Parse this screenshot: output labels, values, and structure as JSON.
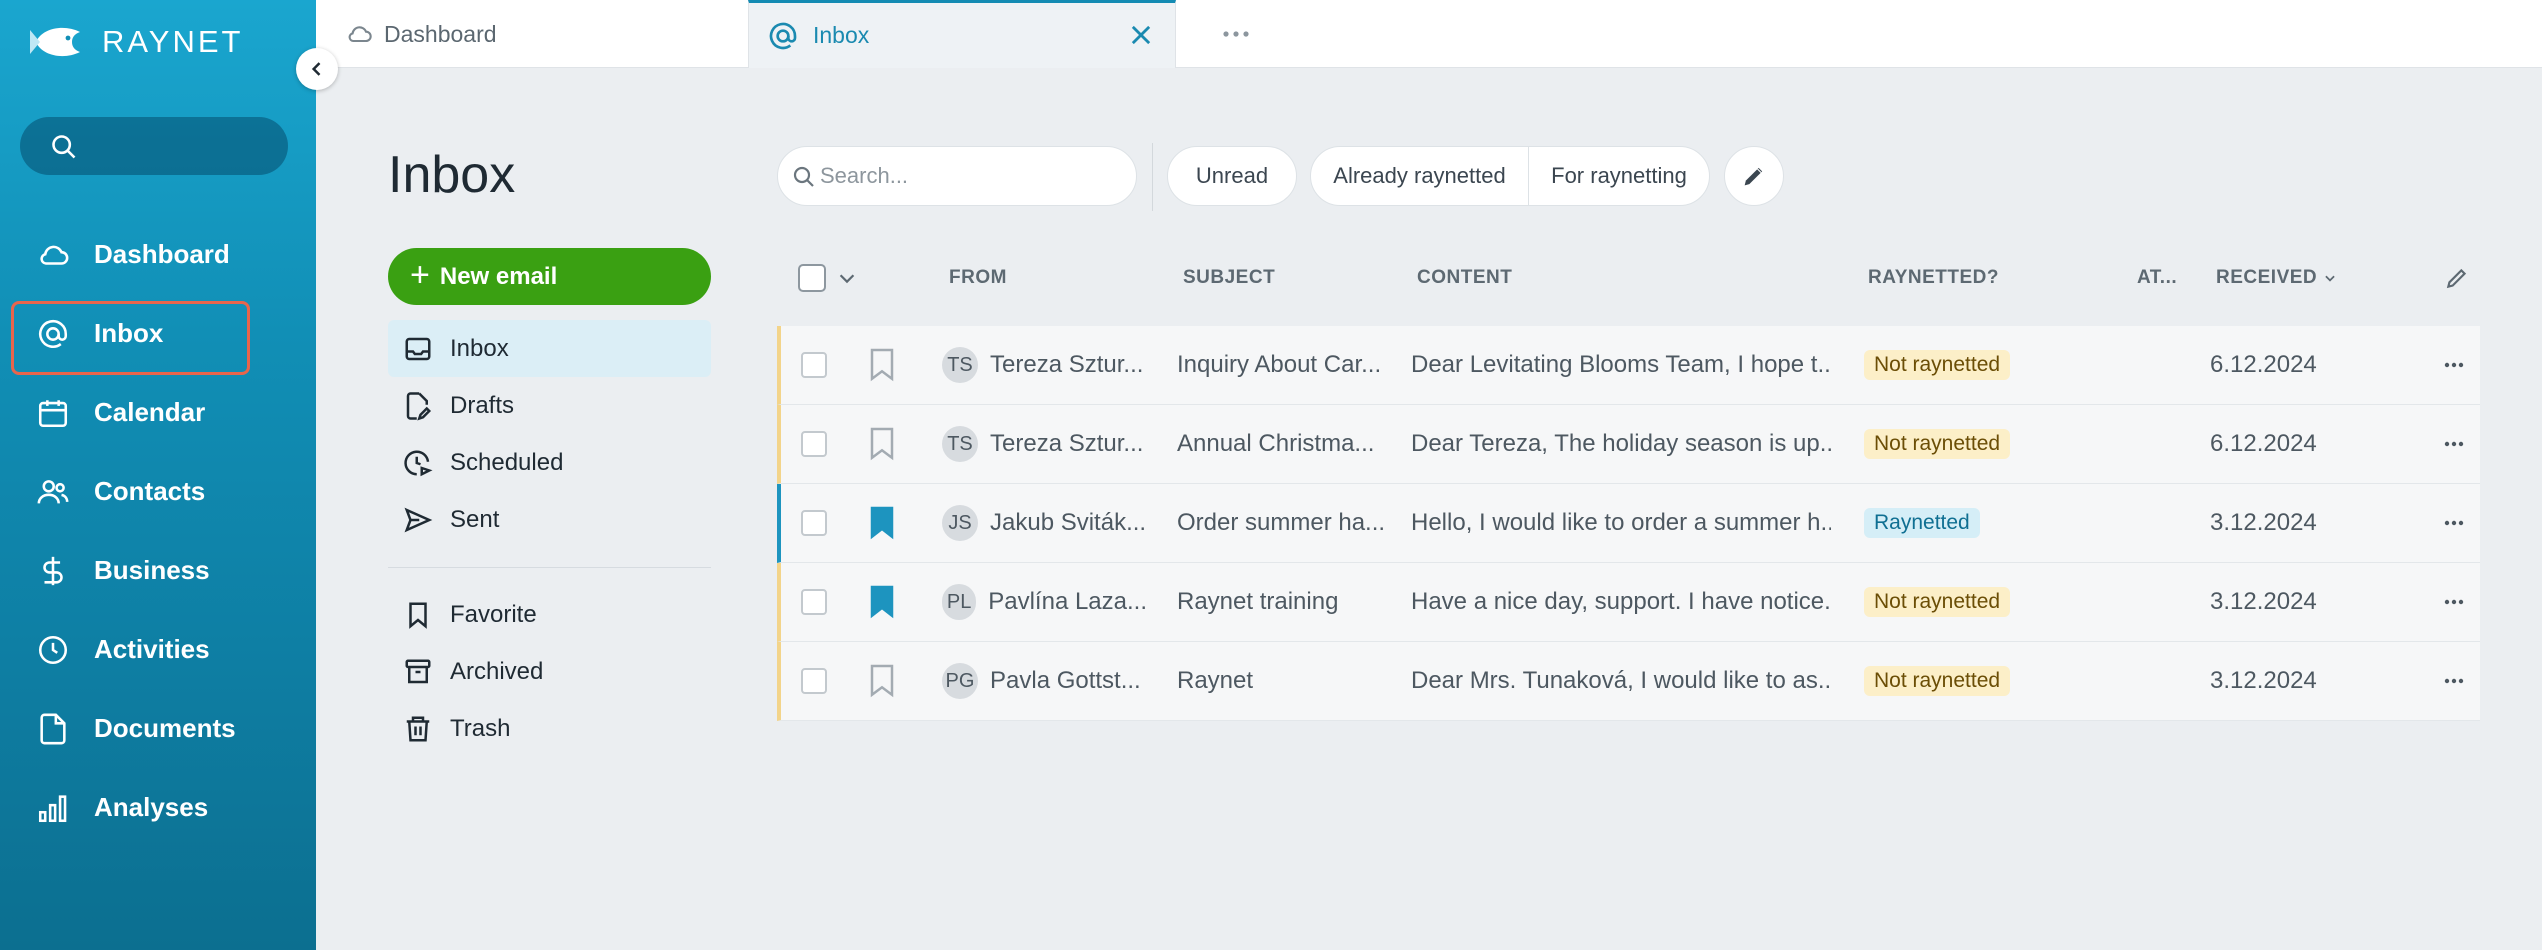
{
  "app": {
    "name": "RAYNET"
  },
  "sidebar": {
    "search_placeholder": "",
    "items": [
      {
        "label": "Dashboard",
        "icon": "cloud-icon"
      },
      {
        "label": "Inbox",
        "icon": "at-icon"
      },
      {
        "label": "Calendar",
        "icon": "calendar-icon"
      },
      {
        "label": "Contacts",
        "icon": "people-icon"
      },
      {
        "label": "Business",
        "icon": "dollar-icon"
      },
      {
        "label": "Activities",
        "icon": "clock-icon"
      },
      {
        "label": "Documents",
        "icon": "document-icon"
      },
      {
        "label": "Analyses",
        "icon": "bar-chart-icon"
      }
    ],
    "active": "Inbox"
  },
  "tabs": [
    {
      "label": "Dashboard",
      "icon": "cloud-icon"
    },
    {
      "label": "Inbox",
      "icon": "at-icon",
      "active": true
    }
  ],
  "page": {
    "title": "Inbox",
    "new_email_label": "New email",
    "folders": [
      {
        "label": "Inbox",
        "icon": "inbox-icon",
        "active": true
      },
      {
        "label": "Drafts",
        "icon": "draft-icon"
      },
      {
        "label": "Scheduled",
        "icon": "scheduled-icon"
      },
      {
        "label": "Sent",
        "icon": "send-icon"
      }
    ],
    "folders2": [
      {
        "label": "Favorite",
        "icon": "bookmark-icon"
      },
      {
        "label": "Archived",
        "icon": "archive-icon"
      },
      {
        "label": "Trash",
        "icon": "trash-icon"
      }
    ]
  },
  "toolbar": {
    "search_placeholder": "Search...",
    "filter_unread": "Unread",
    "filter_already": "Already raynetted",
    "filter_for": "For raynetting"
  },
  "table": {
    "columns": {
      "from": "FROM",
      "subject": "SUBJECT",
      "content": "CONTENT",
      "raynetted": "RAYNETTED?",
      "attachments": "AT...",
      "received": "RECEIVED"
    },
    "rows": [
      {
        "initials": "TS",
        "from": "Tereza Sztur...",
        "subject": "Inquiry About Car...",
        "content": "Dear Levitating Blooms Team, I hope t...",
        "status": "Not raynetted",
        "raynetted": false,
        "favorite": false,
        "received": "6.12.2024"
      },
      {
        "initials": "TS",
        "from": "Tereza Sztur...",
        "subject": "Annual Christma...",
        "content": "Dear Tereza, The holiday season is up...",
        "status": "Not raynetted",
        "raynetted": false,
        "favorite": false,
        "received": "6.12.2024"
      },
      {
        "initials": "JS",
        "from": "Jakub Sviták...",
        "subject": "Order summer ha...",
        "content": "Hello, I would like to order a summer h...",
        "status": "Raynetted",
        "raynetted": true,
        "favorite": true,
        "received": "3.12.2024"
      },
      {
        "initials": "PL",
        "from": "Pavlína Laza...",
        "subject": "Raynet training",
        "content": "Have a nice day, support. I have notice...",
        "status": "Not raynetted",
        "raynetted": false,
        "favorite": true,
        "received": "3.12.2024"
      },
      {
        "initials": "PG",
        "from": "Pavla Gottst...",
        "subject": "Raynet",
        "content": "Dear Mrs. Tunaková, I would like to as...",
        "status": "Not raynetted",
        "raynetted": false,
        "favorite": false,
        "received": "3.12.2024"
      }
    ]
  },
  "colors": {
    "accent": "#138bb3",
    "green": "#3aa012",
    "highlight": "#e8654c"
  }
}
